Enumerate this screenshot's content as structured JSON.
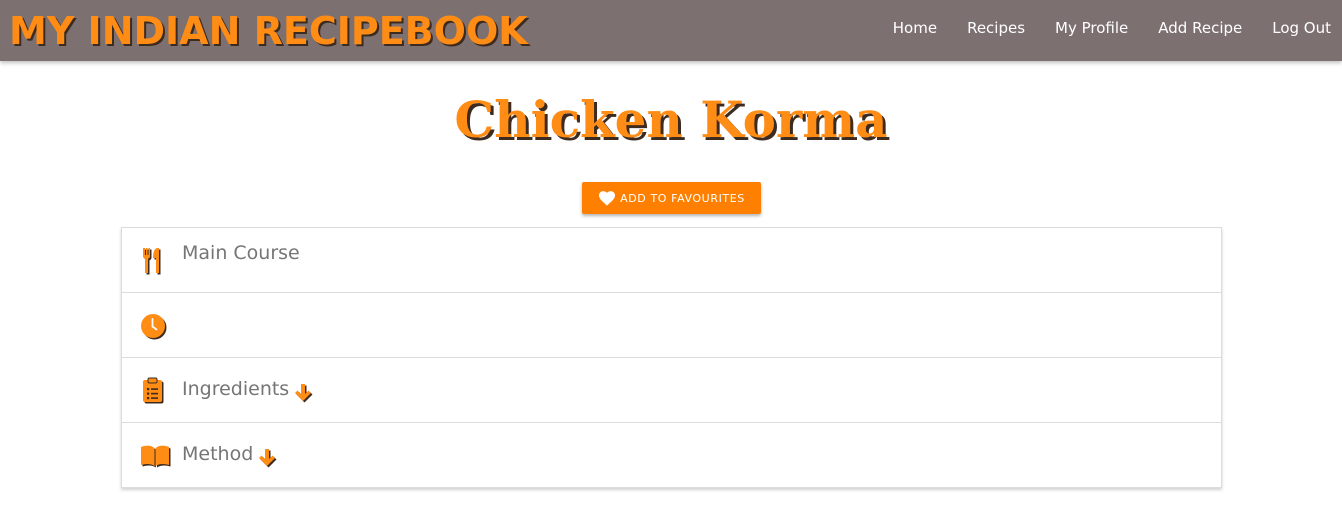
{
  "navbar": {
    "brand": "MY INDIAN RECIPEBOOK",
    "links": [
      {
        "label": "Home"
      },
      {
        "label": "Recipes"
      },
      {
        "label": "My Profile"
      },
      {
        "label": "Add Recipe"
      },
      {
        "label": "Log Out"
      }
    ],
    "background_color": "#7d7071"
  },
  "recipe": {
    "title": "Chicken Korma",
    "favourite_button": {
      "label": "ADD TO FAVOURITES",
      "icon": "heart-icon"
    },
    "details": [
      {
        "icon": "cutlery-icon",
        "label": "Main Course"
      },
      {
        "icon": "clock-icon",
        "label": ""
      },
      {
        "icon": "clipboard-list-icon",
        "label": "Ingredients",
        "expand_icon": "arrow-down-icon"
      },
      {
        "icon": "book-open-icon",
        "label": "Method",
        "expand_icon": "arrow-down-icon"
      }
    ]
  },
  "colors": {
    "accent": "#ff8c14",
    "button": "#ff8000",
    "shadow": "#3d2b1f",
    "muted_text": "#757575"
  }
}
